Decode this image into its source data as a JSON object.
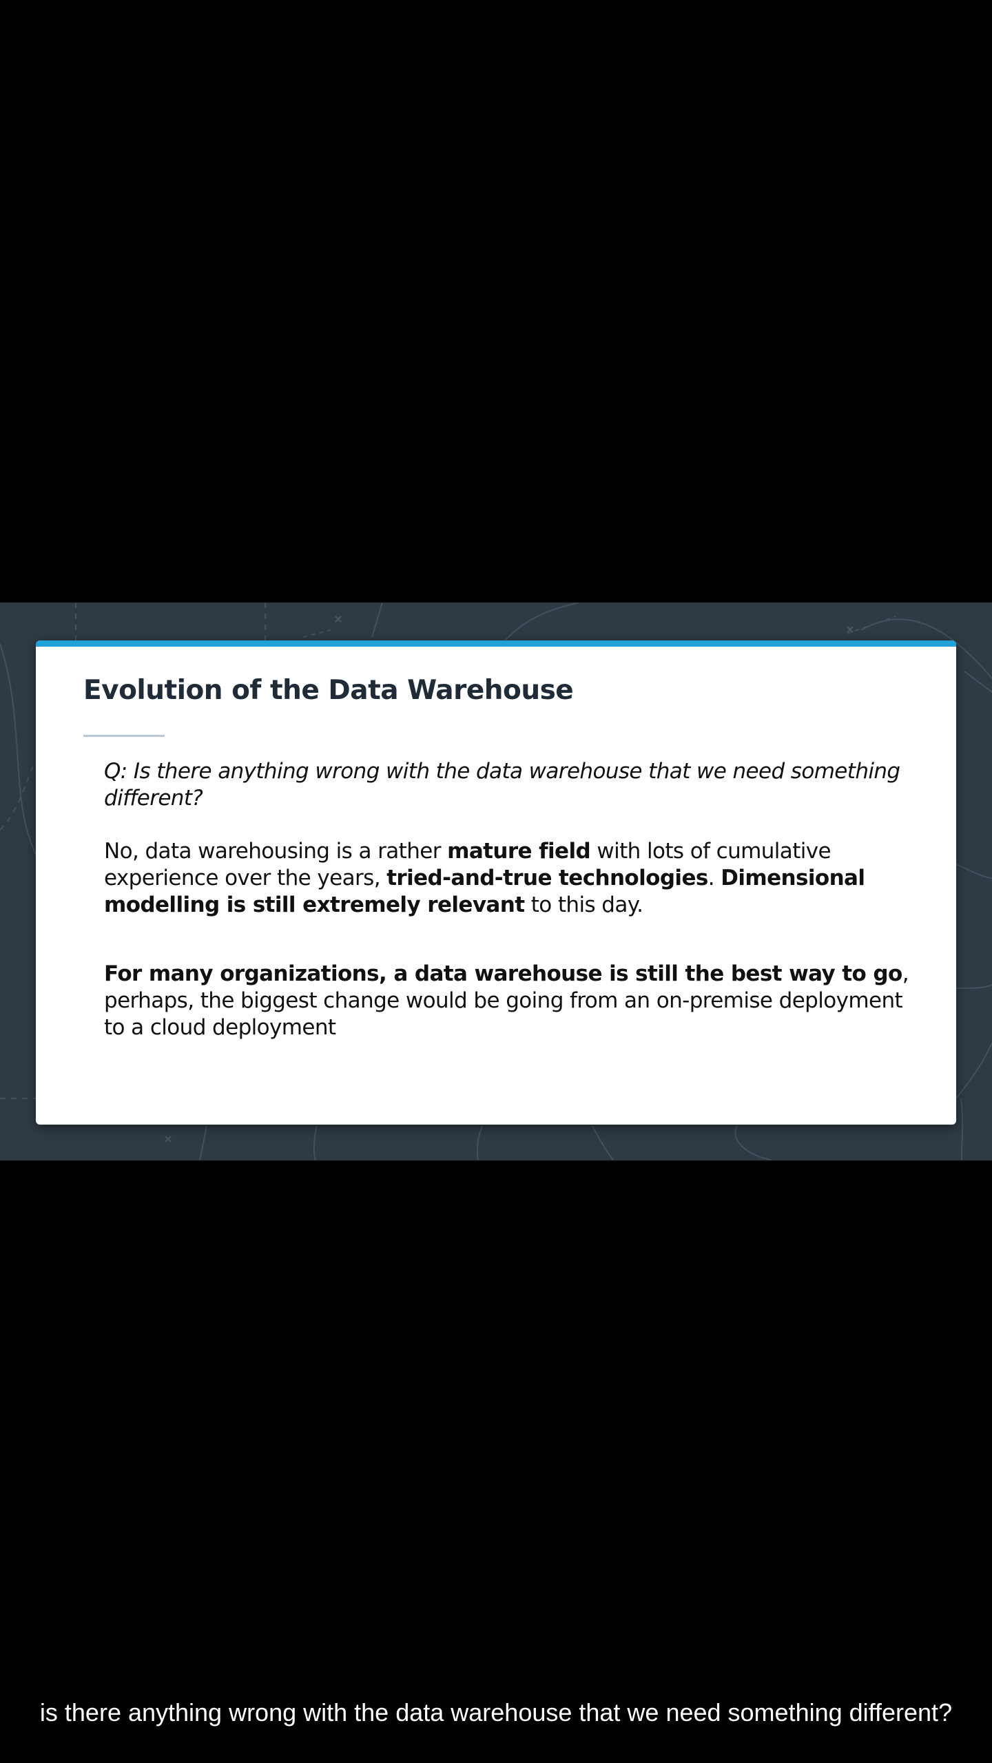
{
  "slide": {
    "title": "Evolution of the Data Warehouse",
    "question": "Q: Is there anything wrong with the data warehouse that we need something different?",
    "answer": {
      "t1": "No, data warehousing is a rather ",
      "b1": "mature field",
      "t2": " with lots of cumulative experience over the years, ",
      "b2": "tried-and-true technologies",
      "t3": ". ",
      "b3": "Dimensional modelling  is still extremely relevant",
      "t4": " to this day."
    },
    "note": {
      "b1": "For many organizations, a data warehouse is still the best way to go",
      "t1": ", perhaps, the biggest change would be going from an on-premise deployment to a cloud deployment"
    }
  },
  "caption": {
    "text": "is there anything wrong with the data warehouse that we need something different?"
  },
  "colors": {
    "page_background": "#000000",
    "slide_background": "#2f3a44",
    "card_background": "#ffffff",
    "accent_bar": "#1ea1d6",
    "title_text": "#1f2b36",
    "caption_text": "#ffffff"
  }
}
